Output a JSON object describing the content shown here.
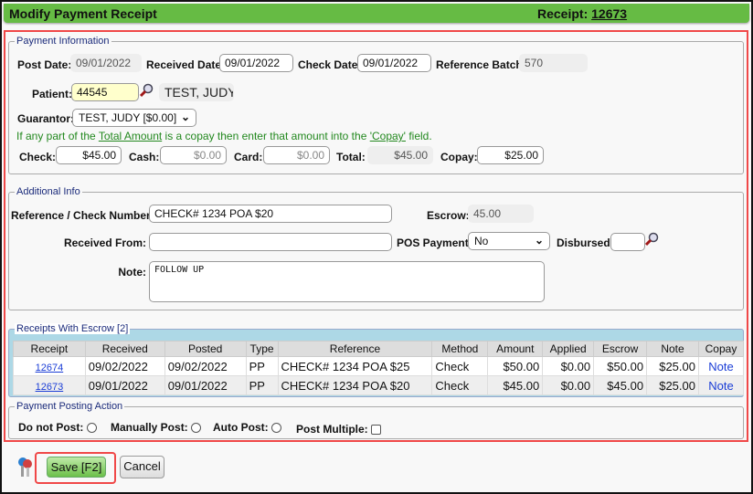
{
  "header": {
    "title": "Modify Payment Receipt",
    "receipt_label": "Receipt:",
    "receipt_number": "12673"
  },
  "payment_info": {
    "legend": "Payment Information",
    "post_date": {
      "label": "Post Date:",
      "value": "09/01/2022"
    },
    "received_date": {
      "label": "Received Date:",
      "value": "09/01/2022"
    },
    "check_date": {
      "label": "Check Date:",
      "value": "09/01/2022"
    },
    "reference_batch": {
      "label": "Reference Batch:",
      "value": "570"
    },
    "patient": {
      "label": "Patient:",
      "value": "44545",
      "name": "TEST, JUDY"
    },
    "guarantor": {
      "label": "Guarantor:",
      "value": "TEST, JUDY [$0.00]"
    },
    "hint": {
      "pre": "If any part of the ",
      "link1": "Total Amount",
      "mid": " is a copay then enter that amount into the ",
      "link2": "'Copay'",
      "post": " field."
    },
    "check": {
      "label": "Check:",
      "value": "$45.00"
    },
    "cash": {
      "label": "Cash:",
      "value": "$0.00"
    },
    "card": {
      "label": "Card:",
      "value": "$0.00"
    },
    "total": {
      "label": "Total:",
      "value": "$45.00"
    },
    "copay": {
      "label": "Copay:",
      "value": "$25.00"
    }
  },
  "additional_info": {
    "legend": "Additional Info",
    "reference": {
      "label": "Reference / Check Number:",
      "value": "CHECK# 1234 POA $20"
    },
    "escrow": {
      "label": "Escrow:",
      "value": "45.00"
    },
    "received_from": {
      "label": "Received From:",
      "value": ""
    },
    "pos_payment": {
      "label": "POS Payment:",
      "value": "No"
    },
    "disbursed": {
      "label": "Disbursed:",
      "value": ""
    },
    "note": {
      "label": "Note:",
      "value": "FOLLOW UP"
    }
  },
  "receipts": {
    "legend": "Receipts With Escrow [2]",
    "columns": [
      "Receipt",
      "Received",
      "Posted",
      "Type",
      "Reference",
      "Method",
      "Amount",
      "Applied",
      "Escrow",
      "Note",
      "Copay"
    ],
    "rows": [
      [
        "12674",
        "09/02/2022",
        "09/02/2022",
        "PP",
        "CHECK# 1234 POA $25",
        "Check",
        "$50.00",
        "$0.00",
        "$50.00",
        "$25.00",
        "Note"
      ],
      [
        "12673",
        "09/01/2022",
        "09/01/2022",
        "PP",
        "CHECK# 1234 POA $20",
        "Check",
        "$45.00",
        "$0.00",
        "$45.00",
        "$25.00",
        "Note"
      ]
    ]
  },
  "posting_action": {
    "legend": "Payment Posting Action",
    "options": [
      "Do not Post:",
      "Manually Post:",
      "Auto Post:"
    ],
    "post_multiple": "Post Multiple:"
  },
  "buttons": {
    "save": "Save [F2]",
    "cancel": "Cancel"
  },
  "colors": {
    "title_bar": "#66bb44",
    "highlight": "#f04848",
    "table_panel": "#add8e6",
    "hint_text": "#22881e"
  }
}
